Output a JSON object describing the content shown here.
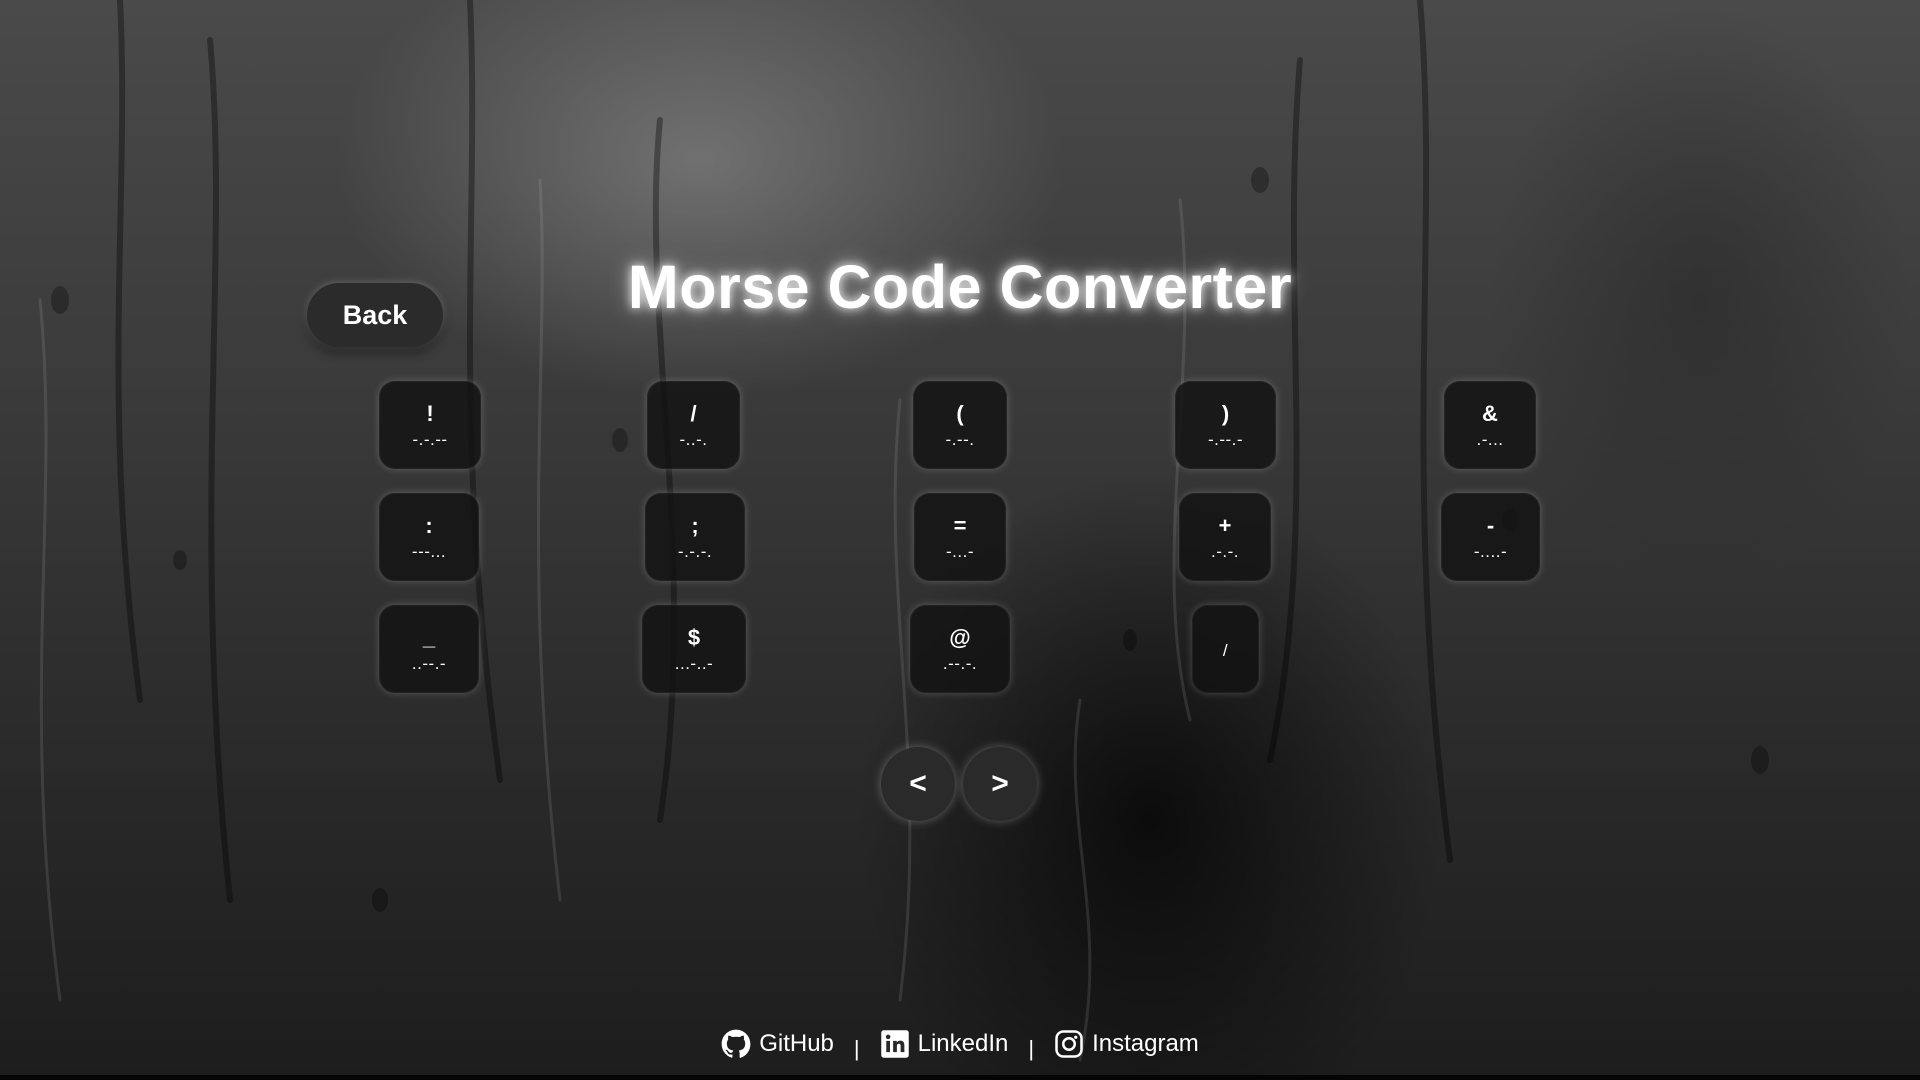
{
  "header": {
    "title": "Morse Code Converter",
    "back_label": "Back"
  },
  "keys": [
    {
      "char": "!",
      "code": "-.-.--"
    },
    {
      "char": "/",
      "code": "-..-."
    },
    {
      "char": "(",
      "code": "-.--."
    },
    {
      "char": ")",
      "code": "-.--.-"
    },
    {
      "char": "&",
      "code": ".-..."
    },
    {
      "char": ":",
      "code": "---..."
    },
    {
      "char": ";",
      "code": "-.-.-."
    },
    {
      "char": "=",
      "code": "-...-"
    },
    {
      "char": "+",
      "code": ".-.-."
    },
    {
      "char": "-",
      "code": "-....-"
    },
    {
      "char": "_",
      "code": "..--.-"
    },
    {
      "char": "$",
      "code": "...-..-"
    },
    {
      "char": "@",
      "code": ".--.-."
    },
    {
      "char": "",
      "code": "/"
    }
  ],
  "pagination": {
    "prev_label": "<",
    "next_label": ">"
  },
  "footer": {
    "links": [
      {
        "label": "GitHub",
        "icon": "github-icon"
      },
      {
        "label": "LinkedIn",
        "icon": "linkedin-icon"
      },
      {
        "label": "Instagram",
        "icon": "instagram-icon"
      }
    ],
    "separator": "|"
  }
}
